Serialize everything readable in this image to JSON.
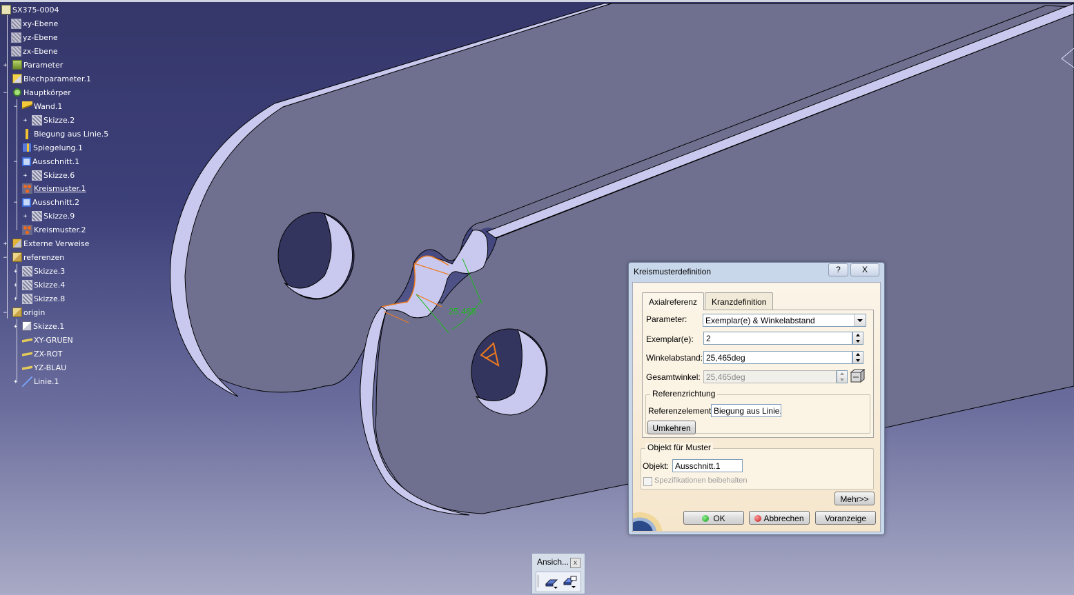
{
  "tree": {
    "root": "SX375-0004",
    "nodes": [
      {
        "label": "xy-Ebene",
        "icon": "plane-icon"
      },
      {
        "label": "yz-Ebene",
        "icon": "plane-icon"
      },
      {
        "label": "zx-Ebene",
        "icon": "plane-icon"
      },
      {
        "label": "Parameter",
        "icon": "parameter-icon"
      },
      {
        "label": "Blechparameter.1",
        "icon": "sheetmetal-parameter-icon"
      },
      {
        "label": "Hauptkörper",
        "icon": "partbody-icon"
      },
      {
        "label": "Wand.1",
        "icon": "wall-icon"
      },
      {
        "label": "Skizze.2",
        "icon": "sketch-icon"
      },
      {
        "label": "Biegung aus Linie.5",
        "icon": "bend-icon"
      },
      {
        "label": "Spiegelung.1",
        "icon": "mirror-icon"
      },
      {
        "label": "Ausschnitt.1",
        "icon": "cutout-icon"
      },
      {
        "label": "Skizze.6",
        "icon": "sketch-icon"
      },
      {
        "label": "Kreismuster.1",
        "icon": "circular-pattern-icon"
      },
      {
        "label": "Ausschnitt.2",
        "icon": "cutout-icon"
      },
      {
        "label": "Skizze.9",
        "icon": "sketch-icon"
      },
      {
        "label": "Kreismuster.2",
        "icon": "circular-pattern-icon"
      },
      {
        "label": "Externe Verweise",
        "icon": "external-references-icon"
      },
      {
        "label": "referenzen",
        "icon": "geometrical-set-icon"
      },
      {
        "label": "Skizze.3",
        "icon": "sketch-icon"
      },
      {
        "label": "Skizze.4",
        "icon": "sketch-icon"
      },
      {
        "label": "Skizze.8",
        "icon": "sketch-icon"
      },
      {
        "label": "origin",
        "icon": "geometrical-set-icon"
      },
      {
        "label": "Skizze.1",
        "icon": "sketch-icon"
      },
      {
        "label": "XY-GRUEN",
        "icon": "plane-icon"
      },
      {
        "label": "ZX-ROT",
        "icon": "plane-icon"
      },
      {
        "label": "YZ-BLAU",
        "icon": "plane-icon"
      },
      {
        "label": "Linie.1",
        "icon": "line-icon"
      }
    ]
  },
  "viewport": {
    "dimension_label": "25,465",
    "part_color": "#6f7090",
    "part_face_color": "#c9c9ef",
    "highlight_color": "#f07a1e",
    "dimension_color": "#22b822"
  },
  "dialog": {
    "title": "Kreismusterdefinition",
    "help_label": "?",
    "close_label": "X",
    "tabs": [
      "Axialreferenz",
      "Kranzdefinition"
    ],
    "active_tab": "Axialreferenz",
    "parameter_label": "Parameter:",
    "parameter_value": "Exemplar(e) & Winkelabstand",
    "instances_label": "Exemplar(e):",
    "instances_value": "2",
    "angular_spacing_label": "Winkelabstand:",
    "angular_spacing_value": "25,465deg",
    "total_angle_label": "Gesamtwinkel:",
    "total_angle_value": "25,465deg",
    "reference_direction_title": "Referenzrichtung",
    "reference_element_label": "Referenzelement:",
    "reference_element_value": "Biegung aus Linie.",
    "reverse_label": "Umkehren",
    "object_group_title": "Objekt für Muster",
    "object_label": "Objekt:",
    "object_value": "Ausschnitt.1",
    "keep_specs_label": "Spezifikationen beibehalten",
    "more_label": "Mehr>>",
    "ok_label": "OK",
    "cancel_label": "Abbrechen",
    "preview_label": "Voranzeige"
  },
  "view_toolbar": {
    "title": "Ansich...",
    "close_label": "x"
  }
}
